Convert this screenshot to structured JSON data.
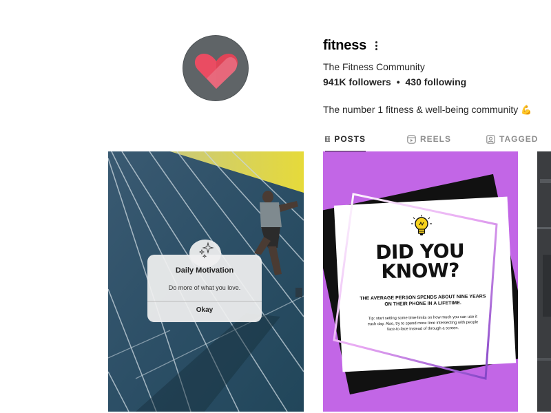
{
  "profile": {
    "username": "fitness",
    "full_name": "The Fitness Community",
    "followers": "941K followers",
    "separator": "•",
    "following": "430 following",
    "bio": "The number 1 fitness & well-being community",
    "bio_emoji": "💪",
    "avatar_icon": "heart-icon",
    "avatar_colors": {
      "background": "#5f6467",
      "heart_left": "#ea4c62",
      "heart_right": "#e06a7e"
    }
  },
  "tabs": [
    {
      "label": "POSTS",
      "icon": "grid-icon",
      "active": true
    },
    {
      "label": "REELS",
      "icon": "reels-icon",
      "active": false
    },
    {
      "label": "TAGGED",
      "icon": "tagged-icon",
      "active": false
    }
  ],
  "posts": {
    "motivation": {
      "dialog_title": "Daily Motivation",
      "dialog_message": "Do more of what you love.",
      "dialog_button": "Okay",
      "icon": "sparkle-icon"
    },
    "did_you_know": {
      "headline_line1": "DID YOU",
      "headline_line2": "KNOW?",
      "subheading": "THE AVERAGE PERSON SPENDS ABOUT NINE YEARS ON THEIR PHONE IN A LIFETIME.",
      "tip": "Tip: start setting some time-limits on how much you can use it each day. Also, try to spend more time intersecting with people face-to-face instead of through a screen.",
      "icon": "lightbulb-icon",
      "background_color": "#c266e6"
    }
  }
}
